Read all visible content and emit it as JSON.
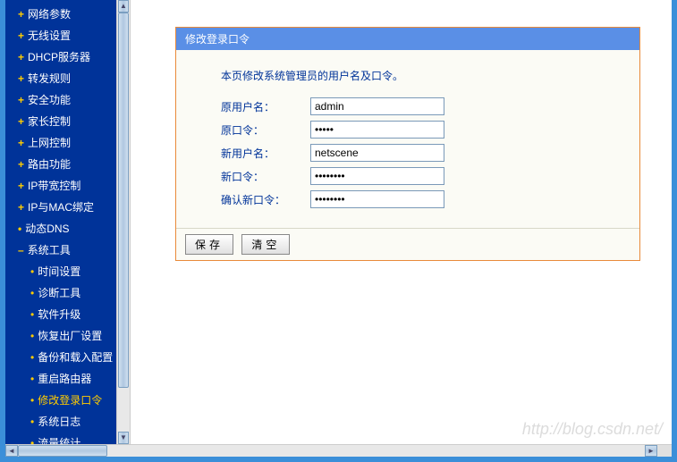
{
  "sidebar": {
    "items": [
      {
        "label": "网络参数",
        "type": "plus"
      },
      {
        "label": "无线设置",
        "type": "plus"
      },
      {
        "label": "DHCP服务器",
        "type": "plus"
      },
      {
        "label": "转发规则",
        "type": "plus"
      },
      {
        "label": "安全功能",
        "type": "plus"
      },
      {
        "label": "家长控制",
        "type": "plus"
      },
      {
        "label": "上网控制",
        "type": "plus"
      },
      {
        "label": "路由功能",
        "type": "plus"
      },
      {
        "label": "IP带宽控制",
        "type": "plus"
      },
      {
        "label": "IP与MAC绑定",
        "type": "plus"
      },
      {
        "label": "动态DNS",
        "type": "dot"
      },
      {
        "label": "系统工具",
        "type": "minus"
      }
    ],
    "sub_items": [
      {
        "label": "时间设置"
      },
      {
        "label": "诊断工具"
      },
      {
        "label": "软件升级"
      },
      {
        "label": "恢复出厂设置"
      },
      {
        "label": "备份和载入配置"
      },
      {
        "label": "重启路由器"
      },
      {
        "label": "修改登录口令",
        "active": true
      },
      {
        "label": "系统日志"
      },
      {
        "label": "流量统计"
      }
    ]
  },
  "panel": {
    "title": "修改登录口令",
    "description": "本页修改系统管理员的用户名及口令。",
    "fields": {
      "old_user_label": "原用户名：",
      "old_user_value": "admin",
      "old_pass_label": "原口令：",
      "old_pass_value": "•••••",
      "new_user_label": "新用户名：",
      "new_user_value": "netscene",
      "new_pass_label": "新口令：",
      "new_pass_value": "••••••••",
      "confirm_pass_label": "确认新口令：",
      "confirm_pass_value": "••••••••"
    },
    "buttons": {
      "save": "保存",
      "clear": "清空"
    }
  },
  "watermark": "http://blog.csdn.net/"
}
